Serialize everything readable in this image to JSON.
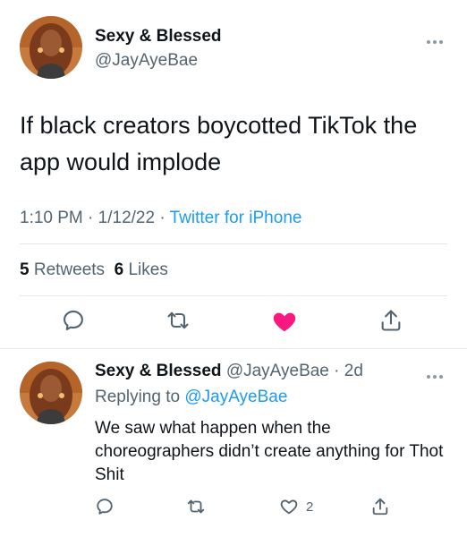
{
  "main_tweet": {
    "display_name": "Sexy & Blessed",
    "handle": "@JayAyeBae",
    "text": "If black creators boycotted TikTok the app would implode",
    "time": "1:10 PM",
    "date": "1/12/22",
    "source": "Twitter for iPhone",
    "retweets": {
      "count": "5",
      "label": "Retweets"
    },
    "likes": {
      "count": "6",
      "label": "Likes"
    },
    "liked": true
  },
  "reply_tweet": {
    "display_name": "Sexy & Blessed",
    "handle": "@JayAyeBae",
    "age": "2d",
    "replying_to_label": "Replying to",
    "replying_to_handle": "@JayAyeBae",
    "text": "We saw what happen when the choreographers didn’t create anything for Thot Shit",
    "like_count": "2"
  },
  "separator": " · ",
  "colors": {
    "link": "#1d9bf0",
    "secondary_text": "#536471",
    "like_active": "#f91880",
    "divider": "#e3e8ec"
  },
  "icons": [
    "reply-icon",
    "retweet-icon",
    "heart-icon",
    "share-icon",
    "more-icon"
  ]
}
